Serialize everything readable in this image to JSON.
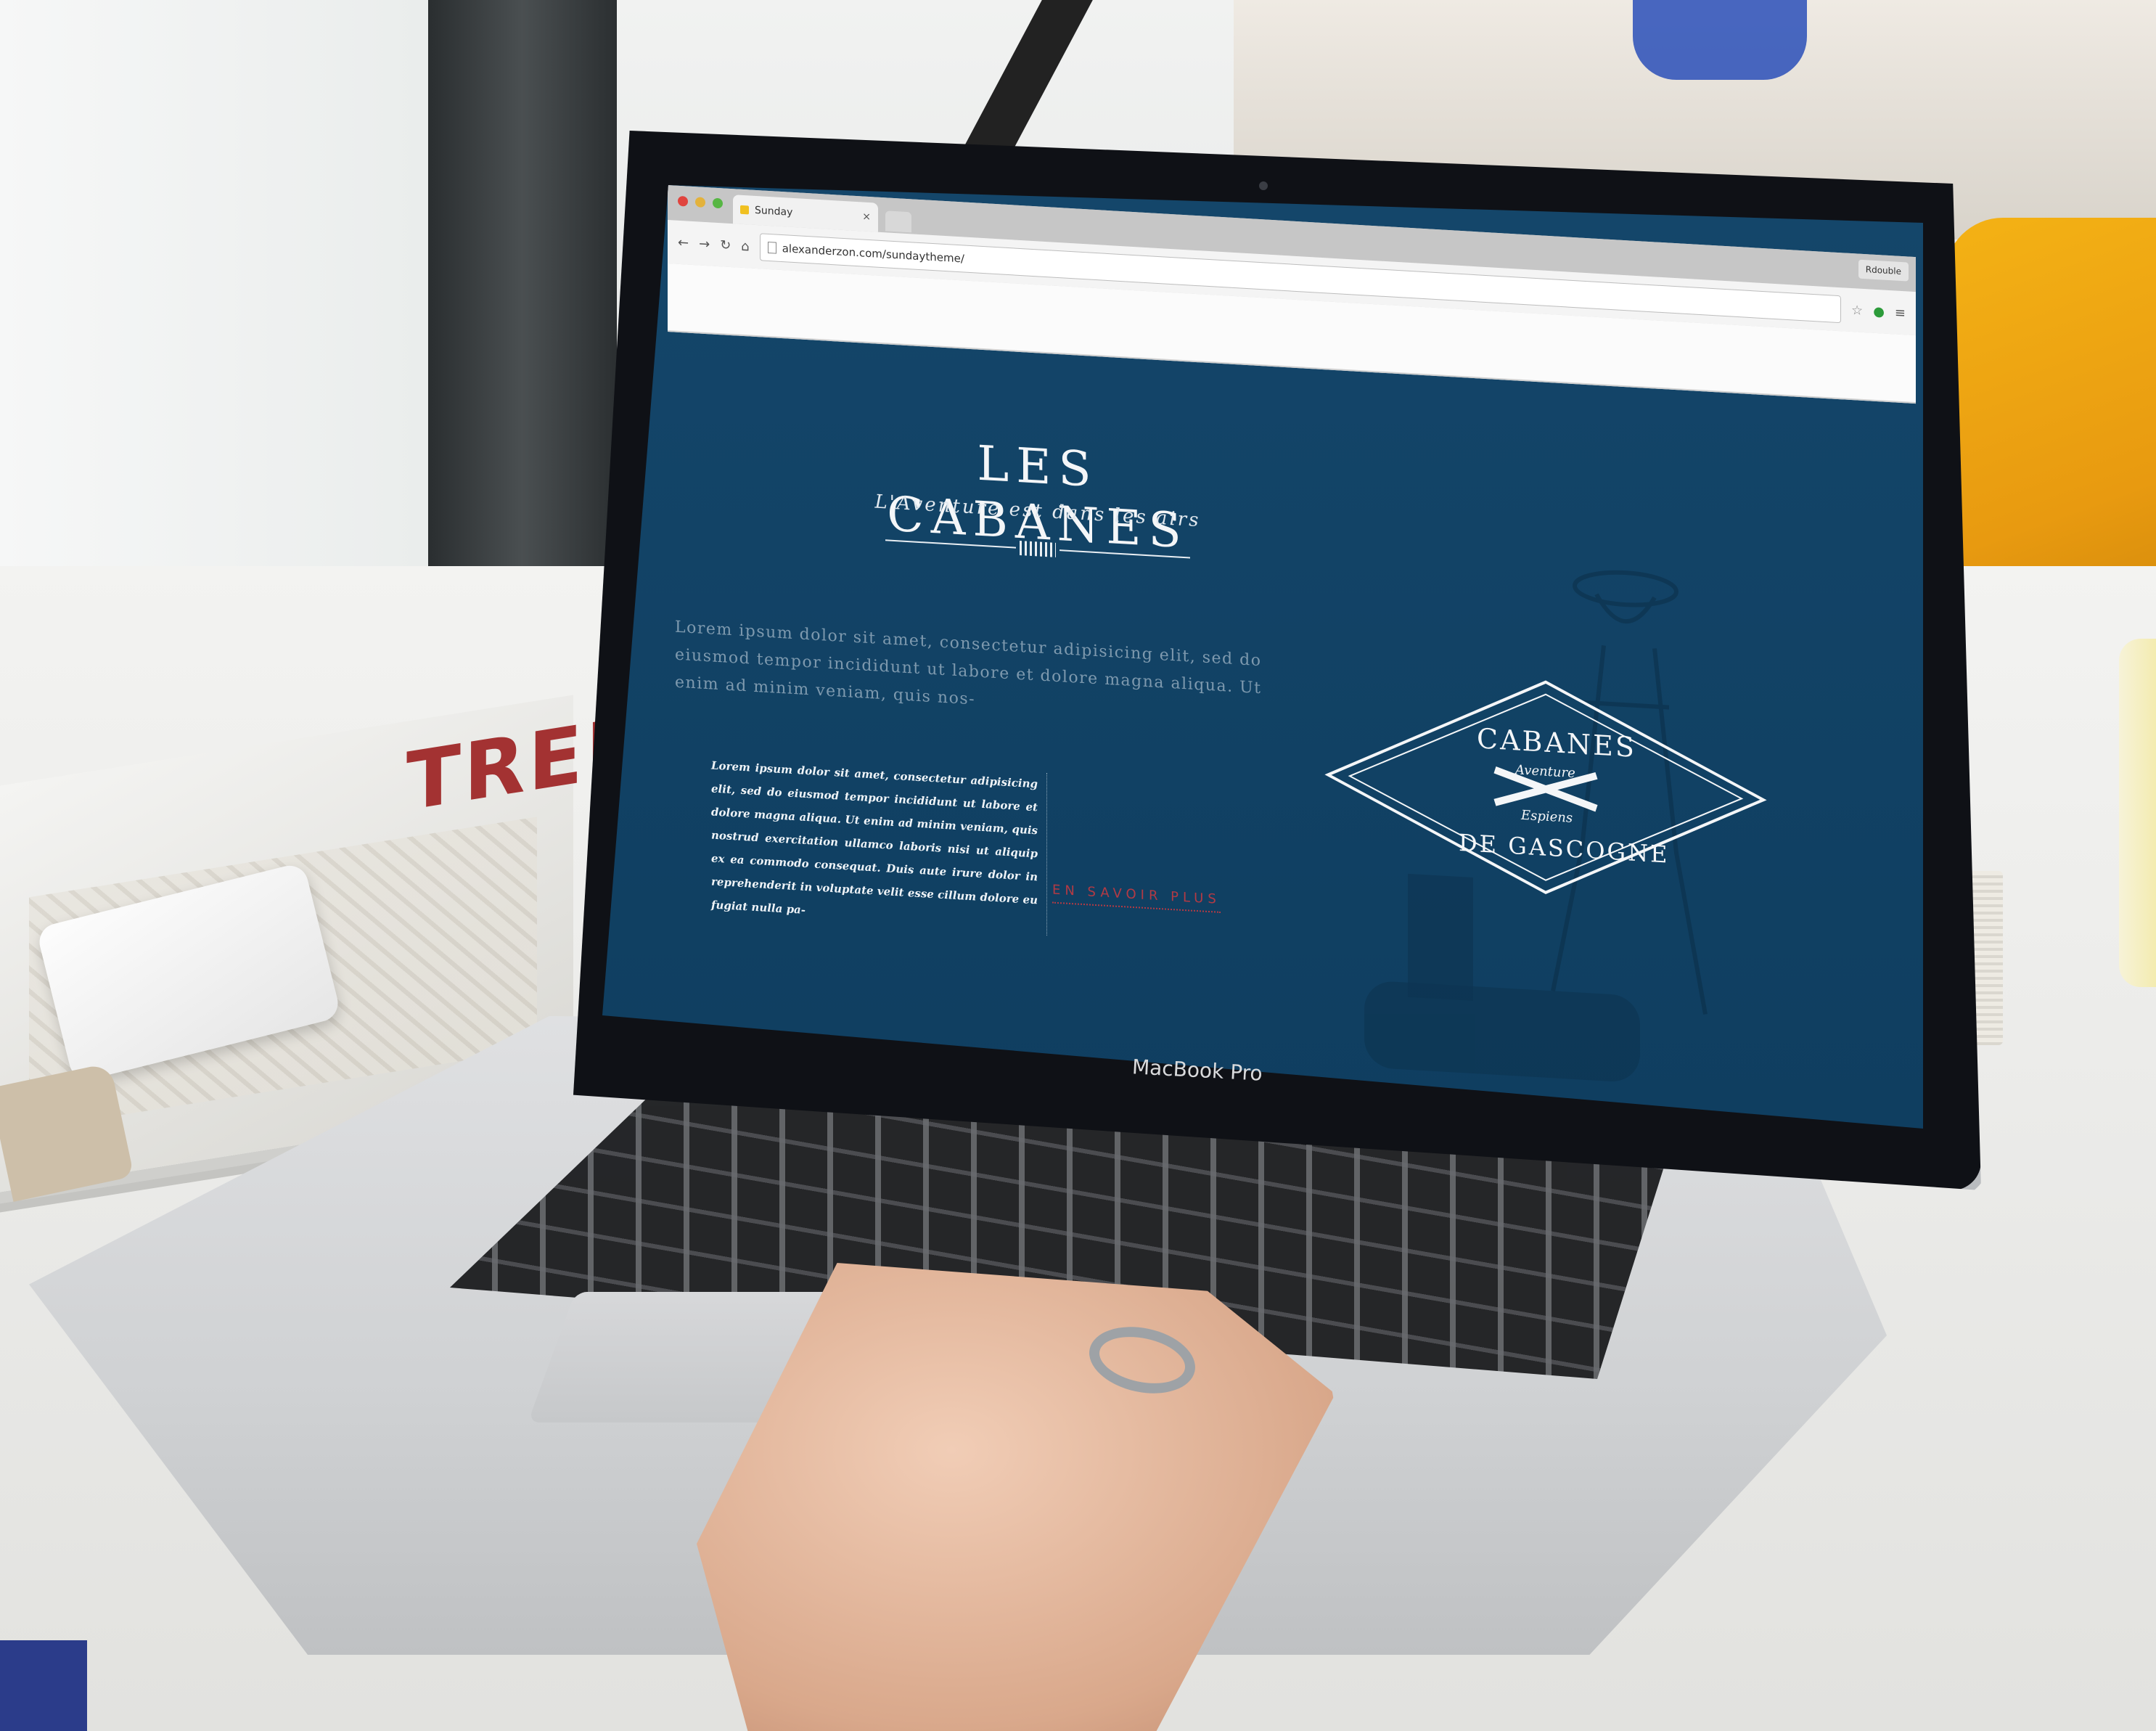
{
  "colors": {
    "screen_bg": "#14466a",
    "link_accent": "#b33a44",
    "text_light": "#e8eef3"
  },
  "browser": {
    "tab_title": "Sunday",
    "tab_close": "×",
    "url": "alexanderzon.com/sundaytheme/",
    "profile": "Rdouble",
    "icons": [
      "back-arrow-icon",
      "forward-arrow-icon",
      "reload-icon",
      "home-icon",
      "star-icon",
      "extension-icon",
      "menu-icon"
    ]
  },
  "site": {
    "title": "LES CABANES",
    "subtitle": "L'Aventure est dans les airs",
    "intro": "Lorem ipsum dolor sit amet, consectetur adipisicing elit, sed do eiusmod tempor incididunt ut labore et dolore magna aliqua. Ut enim ad minim veniam, quis nos-",
    "body": "Lorem ipsum dolor sit amet, consectetur adipisicing elit, sed do eiusmod tempor incididunt ut labore et dolore magna aliqua. Ut enim ad minim veniam, quis nostrud exercitation ullamco laboris nisi ut aliquip ex ea commodo consequat. Duis aute irure dolor in reprehenderit in voluptate velit esse cillum dolore eu fugiat nulla pa-",
    "more_link": "EN SAVOIR PLUS"
  },
  "badge": {
    "top": "CABANES",
    "script_top": "Aventure",
    "script_bottom": "Espiens",
    "bottom": "DE GASCOGNE"
  },
  "laptop": {
    "brand": "MacBook Pro"
  },
  "magazine": {
    "title": "TREK"
  }
}
